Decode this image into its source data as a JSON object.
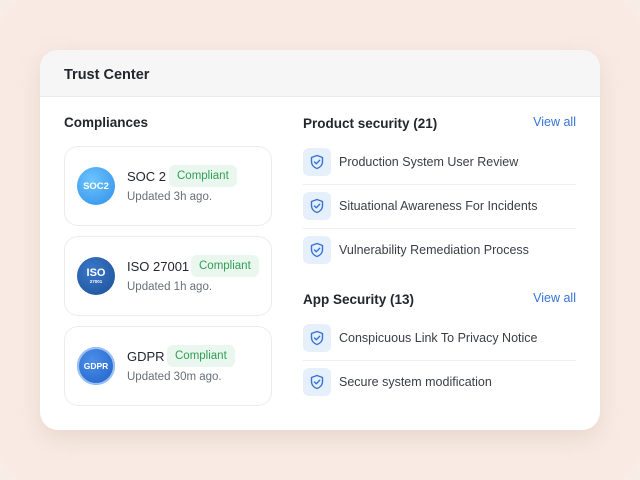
{
  "card": {
    "title": "Trust Center"
  },
  "compliances": {
    "title": "Compliances",
    "items": [
      {
        "badge": "SOC2",
        "name": "SOC 2",
        "status": "Compliant",
        "updated": "Updated 3h ago."
      },
      {
        "badge": "ISO",
        "badge_sub": "27001",
        "name": "ISO 27001",
        "status": "Compliant",
        "updated": "Updated 1h ago."
      },
      {
        "badge": "GDPR",
        "name": "GDPR",
        "status": "Compliant",
        "updated": "Updated 30m ago."
      }
    ]
  },
  "product_security": {
    "title": "Product security (21)",
    "view_all": "View all",
    "items": [
      {
        "label": "Production System User Review",
        "icon": "shield-check-icon"
      },
      {
        "label": "Situational Awareness For Incidents",
        "icon": "shield-check-icon"
      },
      {
        "label": "Vulnerability Remediation Process",
        "icon": "shield-check-icon"
      }
    ]
  },
  "app_security": {
    "title": "App Security (13)",
    "view_all": "View all",
    "items": [
      {
        "label": "Conspicuous Link To Privacy Notice",
        "icon": "shield-check-icon"
      },
      {
        "label": "Secure system modification",
        "icon": "shield-check-icon"
      }
    ]
  },
  "colors": {
    "accent": "#3773d6",
    "compliant_text": "#2f9e55",
    "compliant_bg": "#eaf7ee",
    "page_bg": "#f8ece6"
  }
}
